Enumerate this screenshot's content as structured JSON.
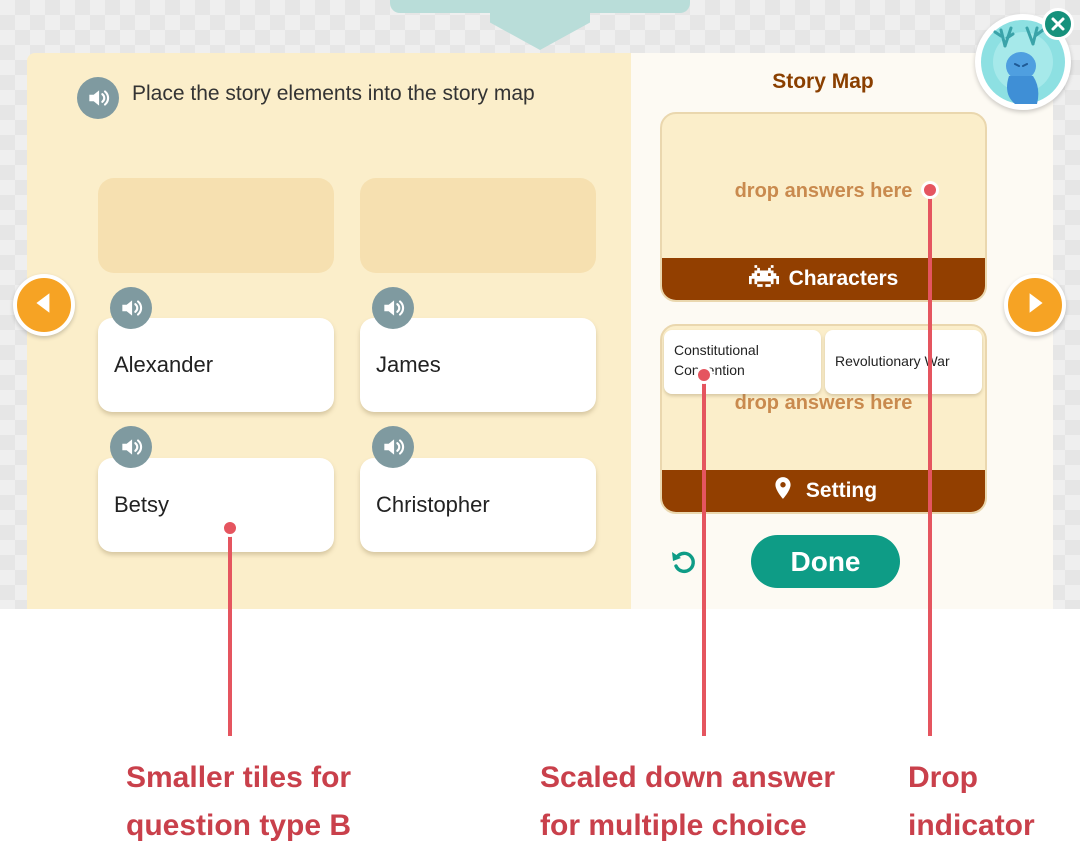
{
  "instruction": {
    "text": "Place the story elements into the story map",
    "audio_icon": "speaker-icon"
  },
  "answer_tiles": [
    {
      "label": "Alexander"
    },
    {
      "label": "James"
    },
    {
      "label": "Betsy"
    },
    {
      "label": "Christopher"
    }
  ],
  "story_map": {
    "title": "Story Map",
    "categories": [
      {
        "label": "Characters",
        "icon": "space-invader-icon",
        "hint": "drop answers here",
        "placed": []
      },
      {
        "label": "Setting",
        "icon": "location-pin-icon",
        "hint": "drop answers here",
        "placed": [
          {
            "label": "Constitutional Convention"
          },
          {
            "label": "Revolutionary War"
          }
        ]
      }
    ]
  },
  "actions": {
    "done_label": "Done",
    "reset_icon": "undo-icon"
  },
  "navigation": {
    "prev_icon": "chevron-left-icon",
    "next_icon": "chevron-right-icon",
    "close_icon": "close-icon"
  },
  "annotations": [
    {
      "line1": "Smaller tiles for",
      "line2": "question type B"
    },
    {
      "line1": "Scaled down answer",
      "line2": "for multiple choice"
    },
    {
      "line1": "Drop",
      "line2": "indicator"
    }
  ],
  "colors": {
    "accent_teal": "#0e9c86",
    "category_brown": "#923f00",
    "nav_orange": "#f6a324",
    "annotation_red": "#e5555f",
    "left_panel_bg": "#fbeeca"
  }
}
